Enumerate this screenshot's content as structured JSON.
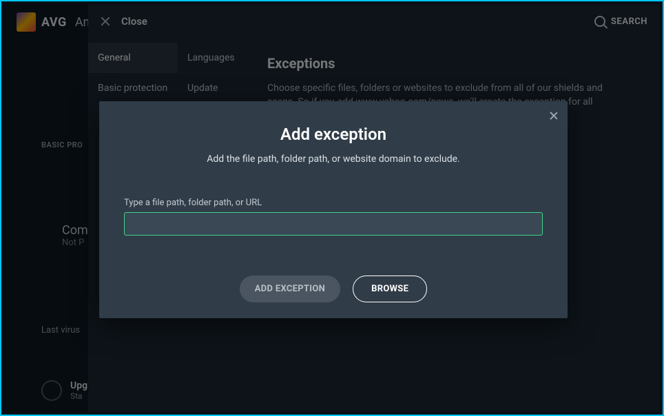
{
  "brand": {
    "name": "AVG",
    "product": "An"
  },
  "settings": {
    "close_label": "Close",
    "search_label": "SEARCH",
    "tabs_left": [
      "General",
      "Basic protection"
    ],
    "tabs_right": [
      "Languages",
      "Update"
    ],
    "page_title": "Exceptions",
    "page_desc": "Choose specific files, folders or websites to exclude from all of our shields and scans. So if you add www.yahoo.com/news, we'll create the exception for all"
  },
  "background": {
    "basic_pro_label": "BASIC PRO",
    "com_line1": "Com",
    "com_line2": "Not P",
    "last_scan": "Last virus",
    "upgrade_t1": "Upg",
    "upgrade_t2": "Sta"
  },
  "modal": {
    "title": "Add exception",
    "subtitle": "Add the file path, folder path, or website domain to exclude.",
    "field_label": "Type a file path, folder path, or URL",
    "input_value": "",
    "add_button": "ADD EXCEPTION",
    "browse_button": "BROWSE"
  }
}
